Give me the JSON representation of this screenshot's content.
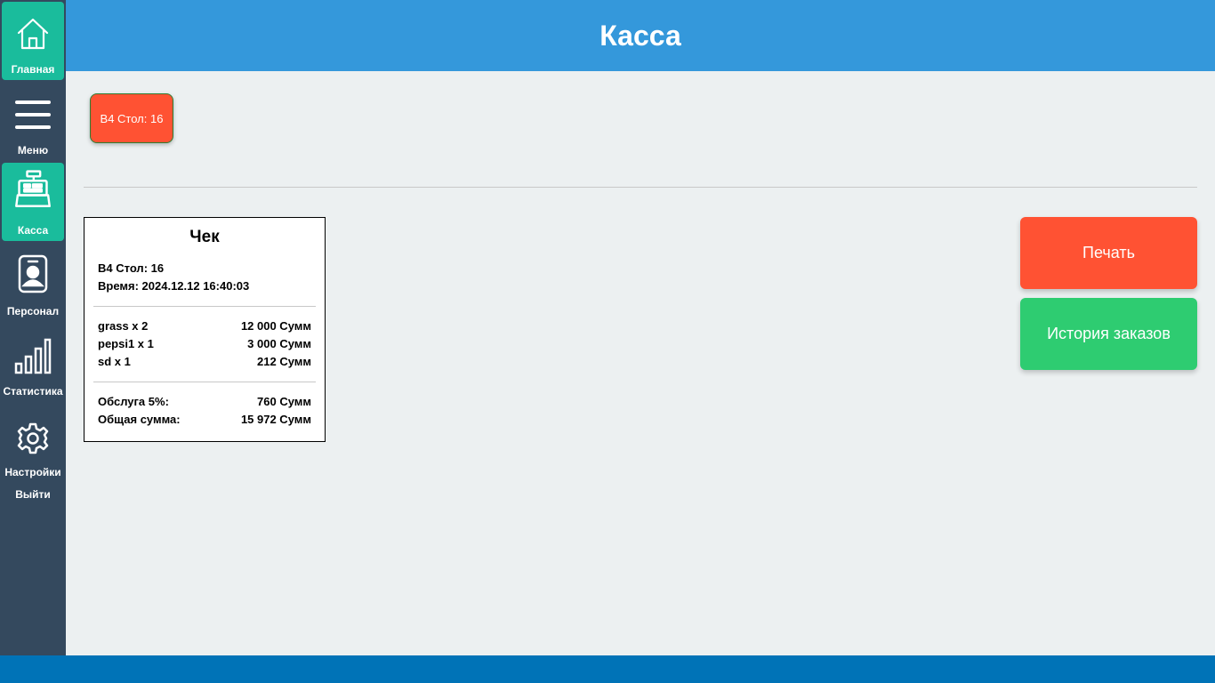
{
  "header": {
    "title": "Касса"
  },
  "sidebar": {
    "items": [
      {
        "label": "Главная",
        "icon": "home-icon",
        "active": true
      },
      {
        "label": "Меню",
        "icon": "menu-icon",
        "active": false
      },
      {
        "label": "Касса",
        "icon": "cash-register-icon",
        "active": true
      },
      {
        "label": "Персонал",
        "icon": "staff-badge-icon",
        "active": false
      },
      {
        "label": "Статистика",
        "icon": "bar-chart-icon",
        "active": false
      },
      {
        "label": "Настройки",
        "icon": "gear-icon",
        "active": false
      }
    ],
    "logout_label": "Выйти"
  },
  "tables": [
    {
      "label": "B4 Стол: 16"
    }
  ],
  "receipt": {
    "title": "Чек",
    "table": "B4 Стол: 16",
    "time": "Время: 2024.12.12 16:40:03",
    "items": [
      {
        "name": "grass x 2",
        "price": "12 000 Сумм"
      },
      {
        "name": "pepsi1 x 1",
        "price": "3 000 Сумм"
      },
      {
        "name": "sd x 1",
        "price": "212 Сумм"
      }
    ],
    "service_label": "Обслуга 5%:",
    "service_value": "760 Сумм",
    "total_label": "Общая сумма:",
    "total_value": "15 972 Сумм"
  },
  "actions": {
    "print_label": "Печать",
    "history_label": "История заказов"
  },
  "colors": {
    "sidebar": "#34495e",
    "active": "#1abc9c",
    "header": "#3498db",
    "accent_red": "#ff5233",
    "accent_green": "#2ecc71",
    "footer": "#0073b7",
    "background": "#ecf0f1"
  }
}
